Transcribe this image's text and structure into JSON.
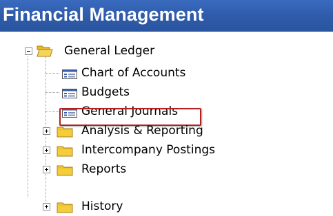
{
  "header": {
    "title": "Financial Management"
  },
  "tree": {
    "root": {
      "label": "General Ledger",
      "expanded": true
    },
    "items": [
      {
        "label": "Chart of Accounts",
        "type": "page"
      },
      {
        "label": "Budgets",
        "type": "page"
      },
      {
        "label": "General Journals",
        "type": "page",
        "selected": true
      },
      {
        "label": "Analysis & Reporting",
        "type": "folder",
        "expanded": false
      },
      {
        "label": "Intercompany Postings",
        "type": "folder",
        "expanded": false
      },
      {
        "label": "Reports",
        "type": "folder",
        "expanded": false
      },
      {
        "label": "History",
        "type": "folder",
        "expanded": false
      }
    ]
  },
  "icons": {
    "collapse": "minus-box-icon",
    "expand": "plus-box-icon",
    "open_folder": "open-folder-icon",
    "folder": "folder-icon",
    "page": "page-list-icon"
  },
  "colors": {
    "header_bg": "#2e5aa8",
    "header_text": "#ffffff",
    "selection_border": "#b3201e",
    "folder": "#f5cd3a"
  }
}
